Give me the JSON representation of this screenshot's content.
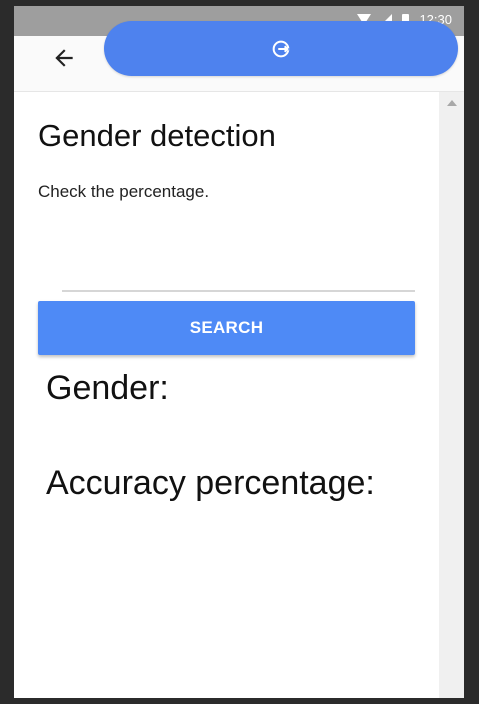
{
  "status_bar": {
    "time": "12:30"
  },
  "app_bar": {
    "back_icon": "arrow-left-icon",
    "action_icon": "enter-arrow-icon"
  },
  "main": {
    "title": "Gender detection",
    "subtitle": "Check the percentage.",
    "search_input": {
      "value": "",
      "placeholder": ""
    },
    "search_button_label": "SEARCH",
    "gender_label": "Gender:",
    "accuracy_label": "Accuracy percentage:"
  },
  "colors": {
    "primary": "#4e8af6",
    "pill": "#4e82ee",
    "status_bar": "#9e9e9e"
  }
}
